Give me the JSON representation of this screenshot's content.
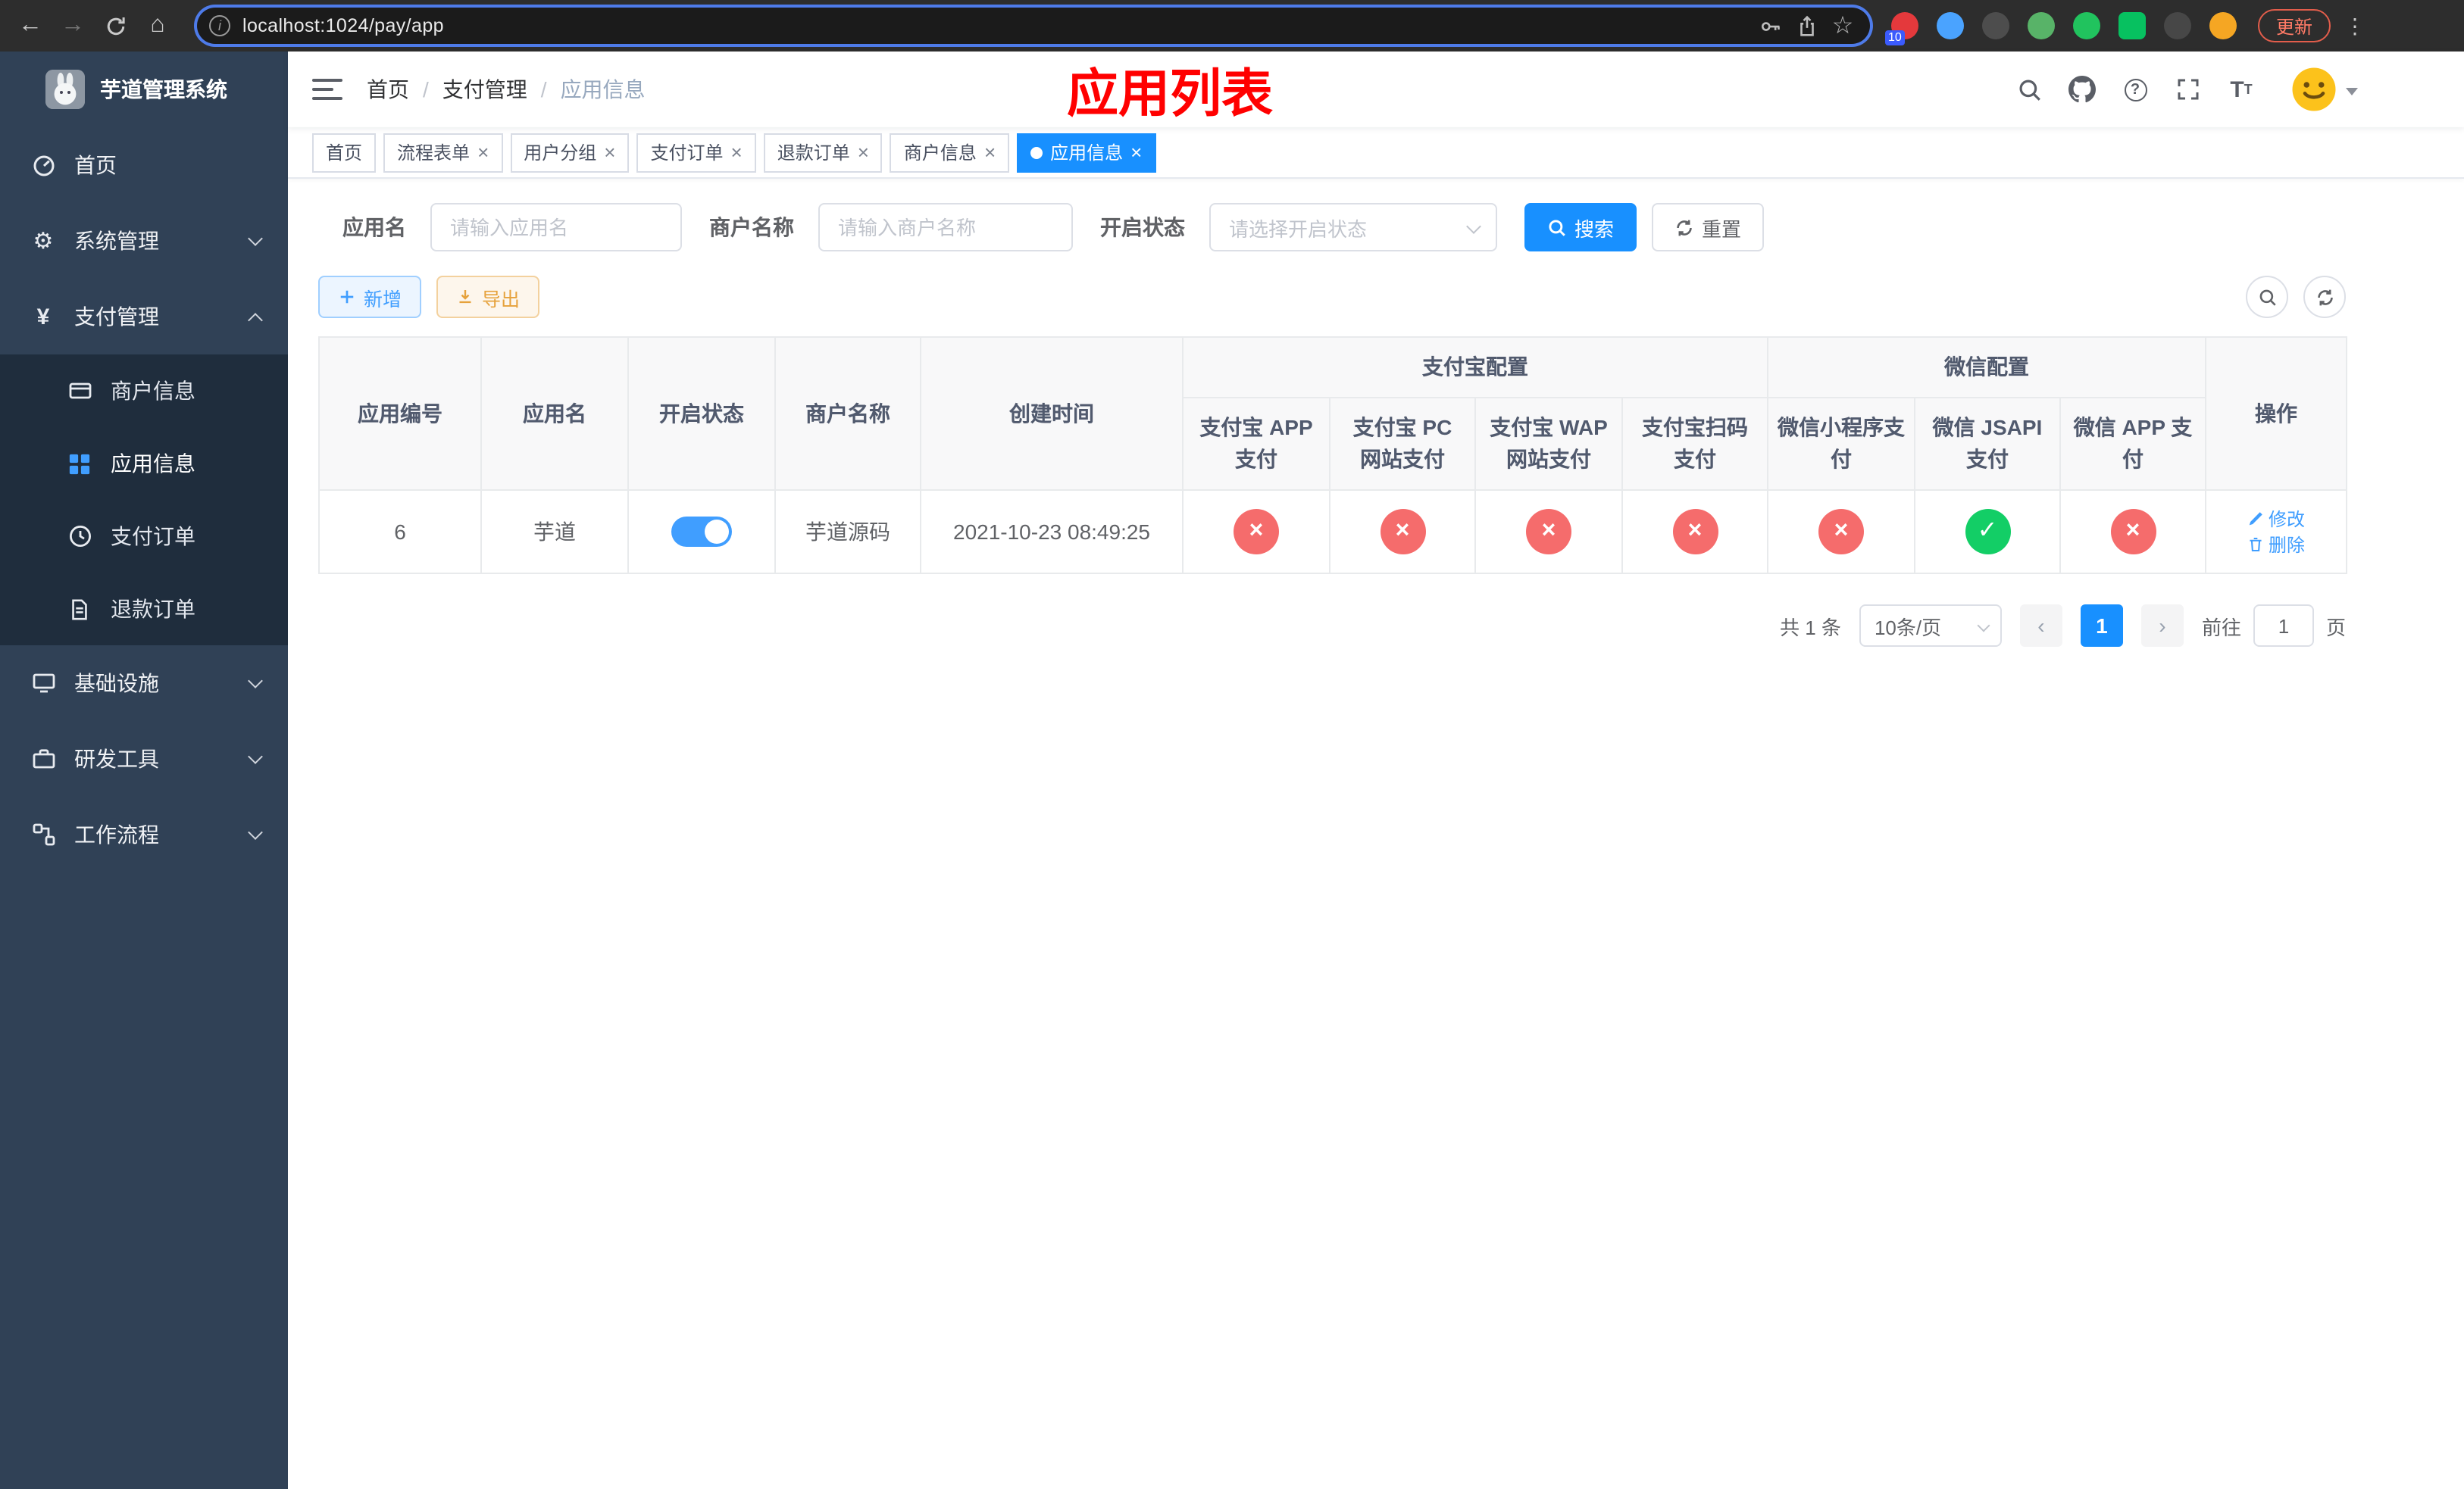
{
  "colors": {
    "accent": "#1890ff",
    "danger": "#f56c6c",
    "success": "#13ce66",
    "annotation_red": "#ff0000",
    "sidebar_bg": "#304156"
  },
  "browser": {
    "url": "localhost:1024/pay/app",
    "update_label": "更新",
    "extensions": [
      {
        "name": "ext-red",
        "badge": "10"
      },
      {
        "name": "ext-blue"
      },
      {
        "name": "ext-dark"
      },
      {
        "name": "ext-avatar"
      },
      {
        "name": "ext-green-circle"
      },
      {
        "name": "ext-green-square"
      },
      {
        "name": "ext-puzzle"
      },
      {
        "name": "ext-orange"
      }
    ]
  },
  "sidebar": {
    "logo_title": "芋道管理系统",
    "menu": [
      {
        "label": "首页"
      },
      {
        "label": "系统管理"
      },
      {
        "label": "支付管理"
      },
      {
        "label": "商户信息"
      },
      {
        "label": "应用信息"
      },
      {
        "label": "支付订单"
      },
      {
        "label": "退款订单"
      },
      {
        "label": "基础设施"
      },
      {
        "label": "研发工具"
      },
      {
        "label": "工作流程"
      }
    ]
  },
  "header": {
    "breadcrumb": [
      "首页",
      "支付管理",
      "应用信息"
    ],
    "annotation": "应用列表"
  },
  "tabs": [
    {
      "label": "首页"
    },
    {
      "label": "流程表单"
    },
    {
      "label": "用户分组"
    },
    {
      "label": "支付订单"
    },
    {
      "label": "退款订单"
    },
    {
      "label": "商户信息"
    },
    {
      "label": "应用信息"
    }
  ],
  "filters": {
    "app_name_label": "应用名",
    "app_name_placeholder": "请输入应用名",
    "merchant_name_label": "商户名称",
    "merchant_name_placeholder": "请输入商户名称",
    "status_label": "开启状态",
    "status_placeholder": "请选择开启状态",
    "search_label": "搜索",
    "reset_label": "重置"
  },
  "toolbar": {
    "add_label": "新增",
    "export_label": "导出"
  },
  "table": {
    "head": {
      "id": "应用编号",
      "name": "应用名",
      "status": "开启状态",
      "merchant": "商户名称",
      "created": "创建时间",
      "alipay_group": "支付宝配置",
      "wechat_group": "微信配置",
      "alipay_app": "支付宝 APP 支付",
      "alipay_pc": "支付宝 PC 网站支付",
      "alipay_wap": "支付宝 WAP 网站支付",
      "alipay_qr": "支付宝扫码支付",
      "wx_mini": "微信小程序支付",
      "wx_jsapi": "微信 JSAPI 支付",
      "wx_app": "微信 APP 支付",
      "ops": "操作"
    },
    "rows": [
      {
        "id": "6",
        "name": "芋道",
        "status_on": true,
        "merchant": "芋道源码",
        "created": "2021-10-23 08:49:25",
        "configs": {
          "alipay_app": {
            "symbol": "×",
            "state": "fail"
          },
          "alipay_pc": {
            "symbol": "×",
            "state": "fail"
          },
          "alipay_wap": {
            "symbol": "×",
            "state": "fail"
          },
          "alipay_qr": {
            "symbol": "×",
            "state": "fail"
          },
          "wx_mini": {
            "symbol": "×",
            "state": "fail"
          },
          "wx_jsapi": {
            "symbol": "✓",
            "state": "ok"
          },
          "wx_app": {
            "symbol": "×",
            "state": "fail"
          }
        },
        "op_edit": "修改",
        "op_delete": "删除"
      }
    ]
  },
  "pagination": {
    "total": "共 1 条",
    "page_size": "10条/页",
    "page": "1",
    "goto_label": "前往",
    "goto_value": "1",
    "goto_unit": "页"
  }
}
